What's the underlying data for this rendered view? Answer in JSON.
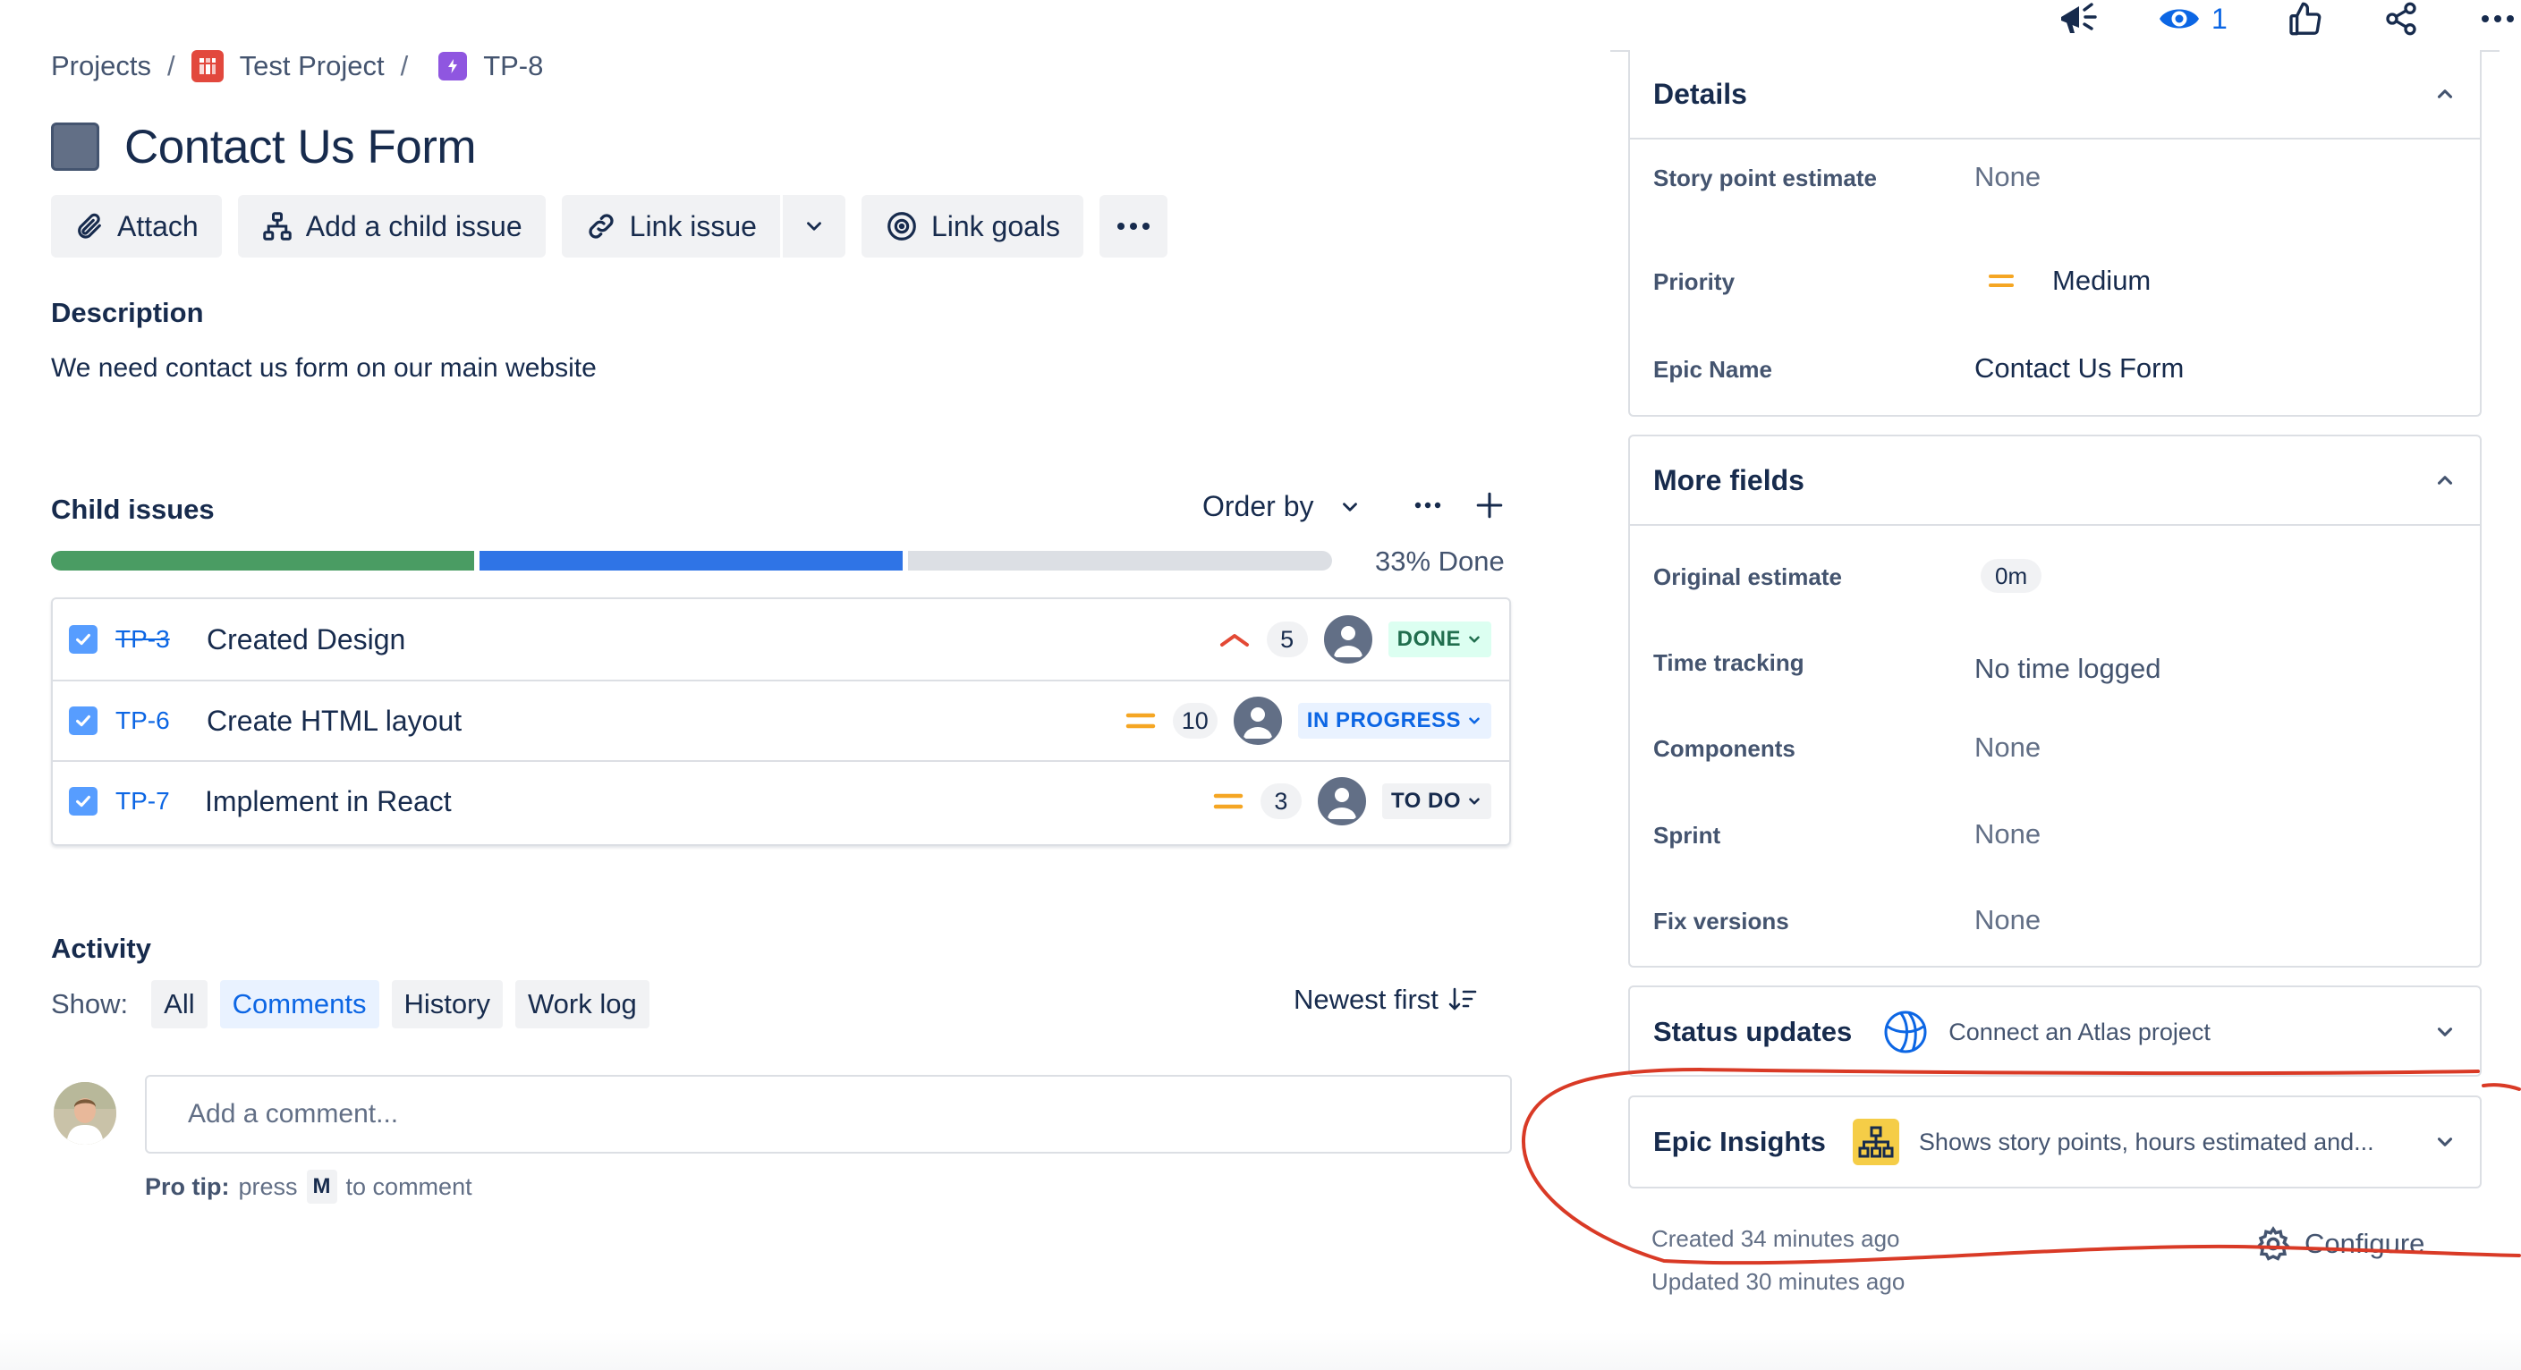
{
  "breadcrumb": {
    "projects": "Projects",
    "separator": "/",
    "project": "Test Project",
    "issue_key": "TP-8"
  },
  "issue": {
    "title": "Contact Us Form"
  },
  "actions": {
    "attach": "Attach",
    "add_child": "Add a child issue",
    "link_issue": "Link issue",
    "link_goals": "Link goals"
  },
  "description": {
    "label": "Description",
    "text": "We need contact us form on our main website"
  },
  "child_issues": {
    "label": "Child issues",
    "order_by": "Order by",
    "progress_label": "33% Done",
    "progress": {
      "done": 0.333,
      "in_progress": 0.333,
      "todo": 0.334
    },
    "rows": [
      {
        "key": "TP-3",
        "summary": "Created Design",
        "priority": "high",
        "points": "5",
        "status": "DONE"
      },
      {
        "key": "TP-6",
        "summary": "Create HTML layout",
        "priority": "medium",
        "points": "10",
        "status": "IN PROGRESS"
      },
      {
        "key": "TP-7",
        "summary": "Implement in React",
        "priority": "medium",
        "points": "3",
        "status": "TO DO"
      }
    ]
  },
  "activity": {
    "label": "Activity",
    "show_label": "Show:",
    "filters": [
      "All",
      "Comments",
      "History",
      "Work log"
    ],
    "active_filter": "Comments",
    "sort": "Newest first",
    "comment_placeholder": "Add a comment...",
    "pro_tip_bold": "Pro tip:",
    "pro_tip_press": "press",
    "pro_tip_key": "M",
    "pro_tip_rest": "to comment"
  },
  "top_icons": {
    "watch_count": "1"
  },
  "details": {
    "title": "Details",
    "fields": [
      {
        "label": "Story point estimate",
        "value": "None"
      },
      {
        "label": "Priority",
        "value": "Medium"
      },
      {
        "label": "Epic Name",
        "value": "Contact Us Form"
      }
    ]
  },
  "more_fields": {
    "title": "More fields",
    "fields": [
      {
        "label": "Original estimate",
        "value": "0m"
      },
      {
        "label": "Time tracking",
        "value": "No time logged"
      },
      {
        "label": "Components",
        "value": "None"
      },
      {
        "label": "Sprint",
        "value": "None"
      },
      {
        "label": "Fix versions",
        "value": "None"
      }
    ]
  },
  "status_updates": {
    "title": "Status updates",
    "subtitle": "Connect an Atlas project"
  },
  "epic_insights": {
    "title": "Epic Insights",
    "subtitle": "Shows story points, hours estimated and..."
  },
  "meta": {
    "created": "Created 34 minutes ago",
    "updated": "Updated 30 minutes ago",
    "configure": "Configure"
  },
  "colors": {
    "done": "#4a9c63",
    "in_progress": "#2f74e6",
    "todo": "#dcdfe4",
    "priority_high": "#e34935",
    "priority_medium": "#f5a623",
    "annotation": "#d93a26"
  }
}
